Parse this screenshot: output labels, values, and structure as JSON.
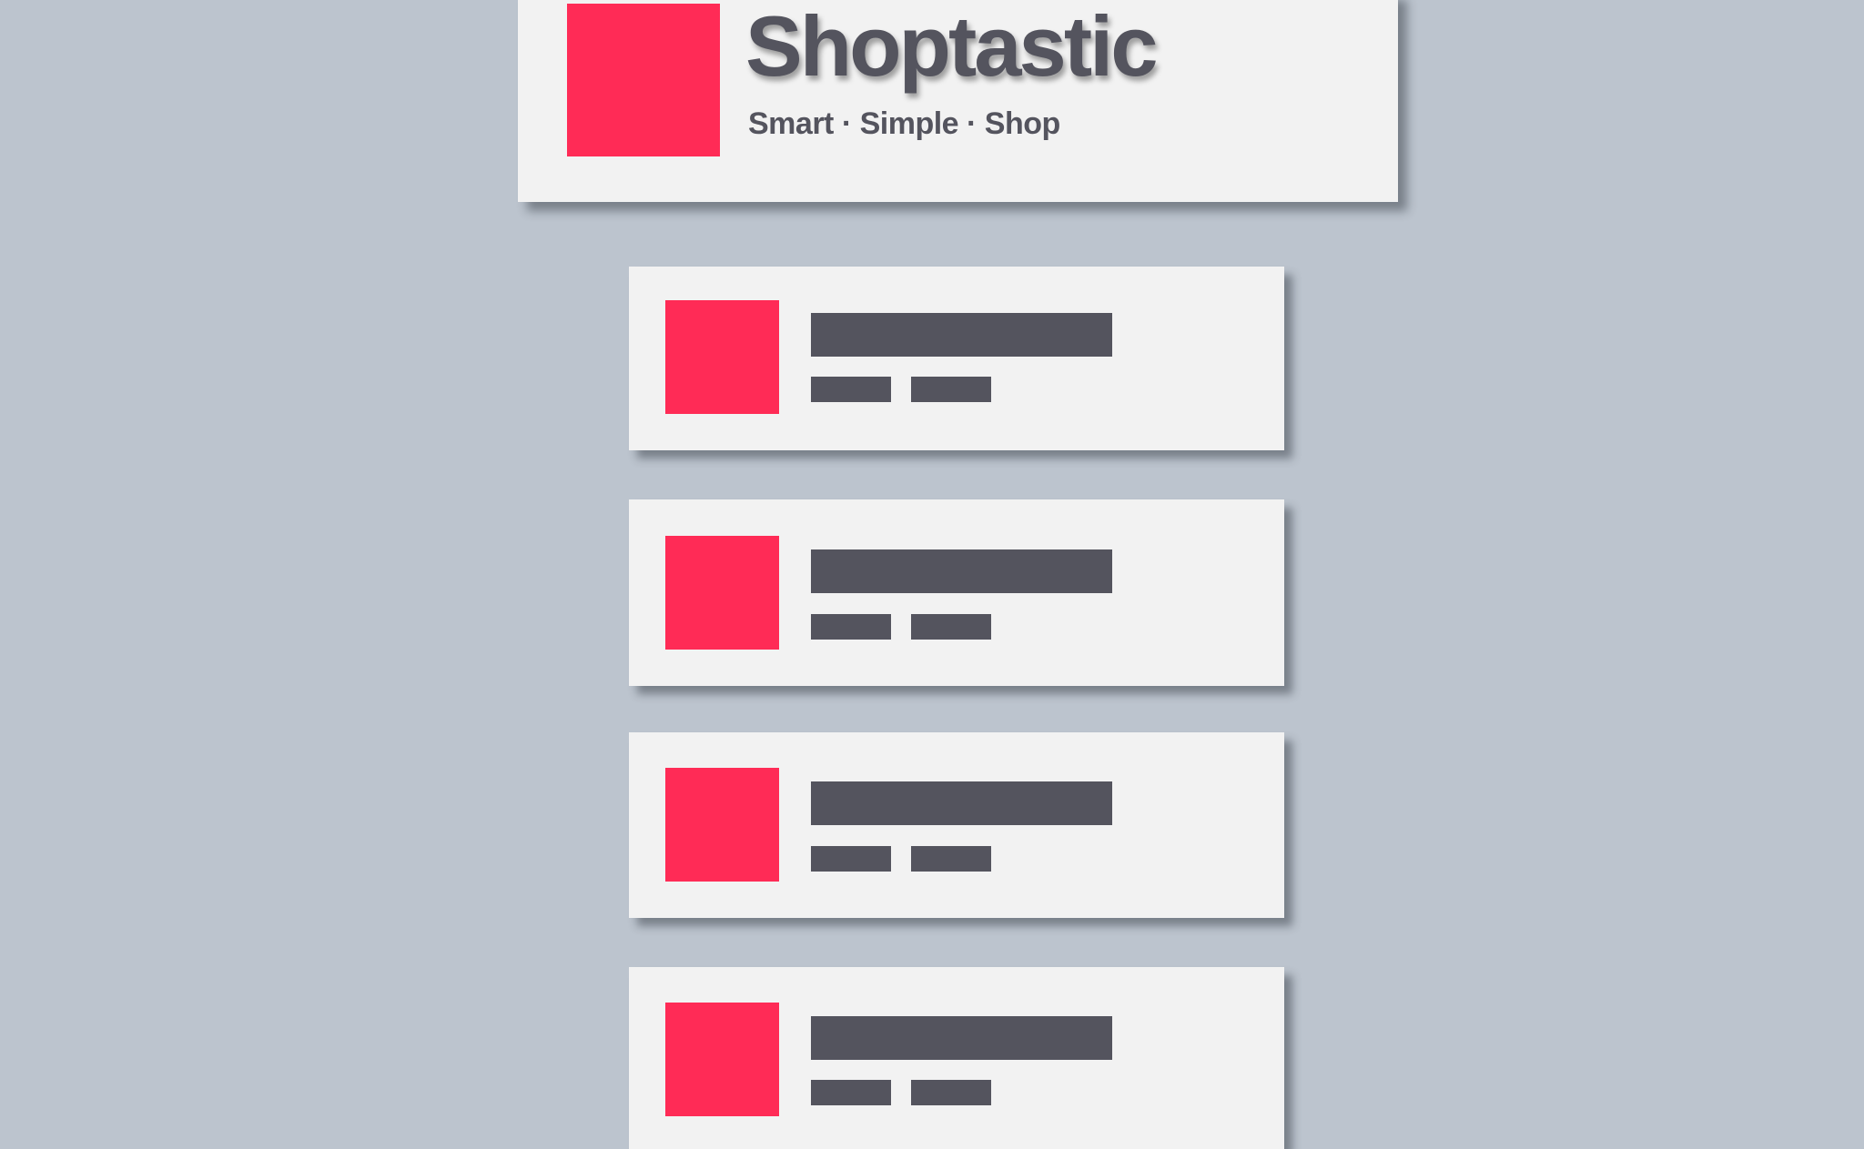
{
  "header": {
    "brand_name": "Shoptastic",
    "tagline": "Smart · Simple · Shop"
  },
  "colors": {
    "background": "#bcc4ce",
    "card": "#f2f2f2",
    "accent": "#ff2b56",
    "placeholder_text": "#54545e"
  },
  "list": {
    "items": [
      {
        "state": "skeleton-placeholder"
      },
      {
        "state": "skeleton-placeholder"
      },
      {
        "state": "skeleton-placeholder"
      },
      {
        "state": "skeleton-placeholder"
      }
    ]
  }
}
